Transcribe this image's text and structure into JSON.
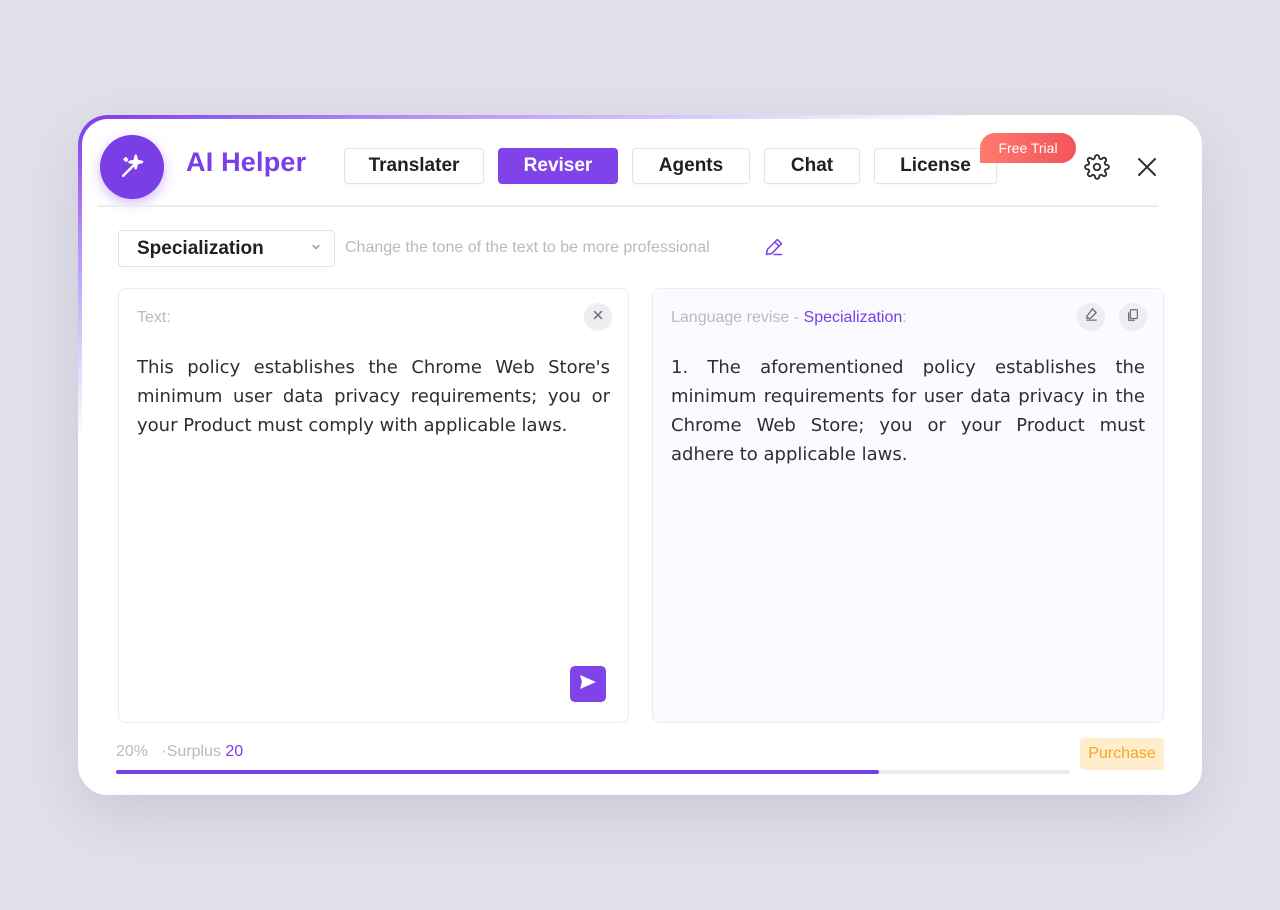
{
  "app": {
    "title": "AI Helper",
    "logo_icon": "magic-wand-icon"
  },
  "tabs": [
    {
      "label": "Translater",
      "active": false
    },
    {
      "label": "Reviser",
      "active": true
    },
    {
      "label": "Agents",
      "active": false
    },
    {
      "label": "Chat",
      "active": false
    },
    {
      "label": "License",
      "active": false
    }
  ],
  "badge": {
    "label": "Free Trial"
  },
  "header_icons": [
    "gear-icon",
    "close-icon"
  ],
  "mode": {
    "selected": "Specialization",
    "description": "Change the tone of the text to be more professional",
    "edit_icon": "pencil-icon"
  },
  "input_panel": {
    "label": "Text:",
    "text": "This policy establishes the Chrome Web Store's minimum user data privacy requirements; you or your Product must comply with applicable laws.",
    "clear_icon": "close-icon",
    "send_icon": "send-icon"
  },
  "output_panel": {
    "label_prefix": "Language revise - ",
    "label_mode": "Specialization",
    "label_suffix": ":",
    "text": "1. The aforementioned policy establishes the minimum requirements for user data privacy in the Chrome Web Store; you or your Product must adhere to applicable laws.",
    "icons": [
      "eraser-icon",
      "copy-icon"
    ]
  },
  "footer": {
    "percent": "20%",
    "surplus_label": "·Surplus",
    "surplus_value": "20",
    "progress_fraction": 0.8,
    "purchase_label": "Purchase"
  },
  "colors": {
    "accent": "#7a3ee6",
    "badge": "#f2545b",
    "purchase_text": "#f5a623",
    "purchase_bg": "#ffedcc"
  }
}
